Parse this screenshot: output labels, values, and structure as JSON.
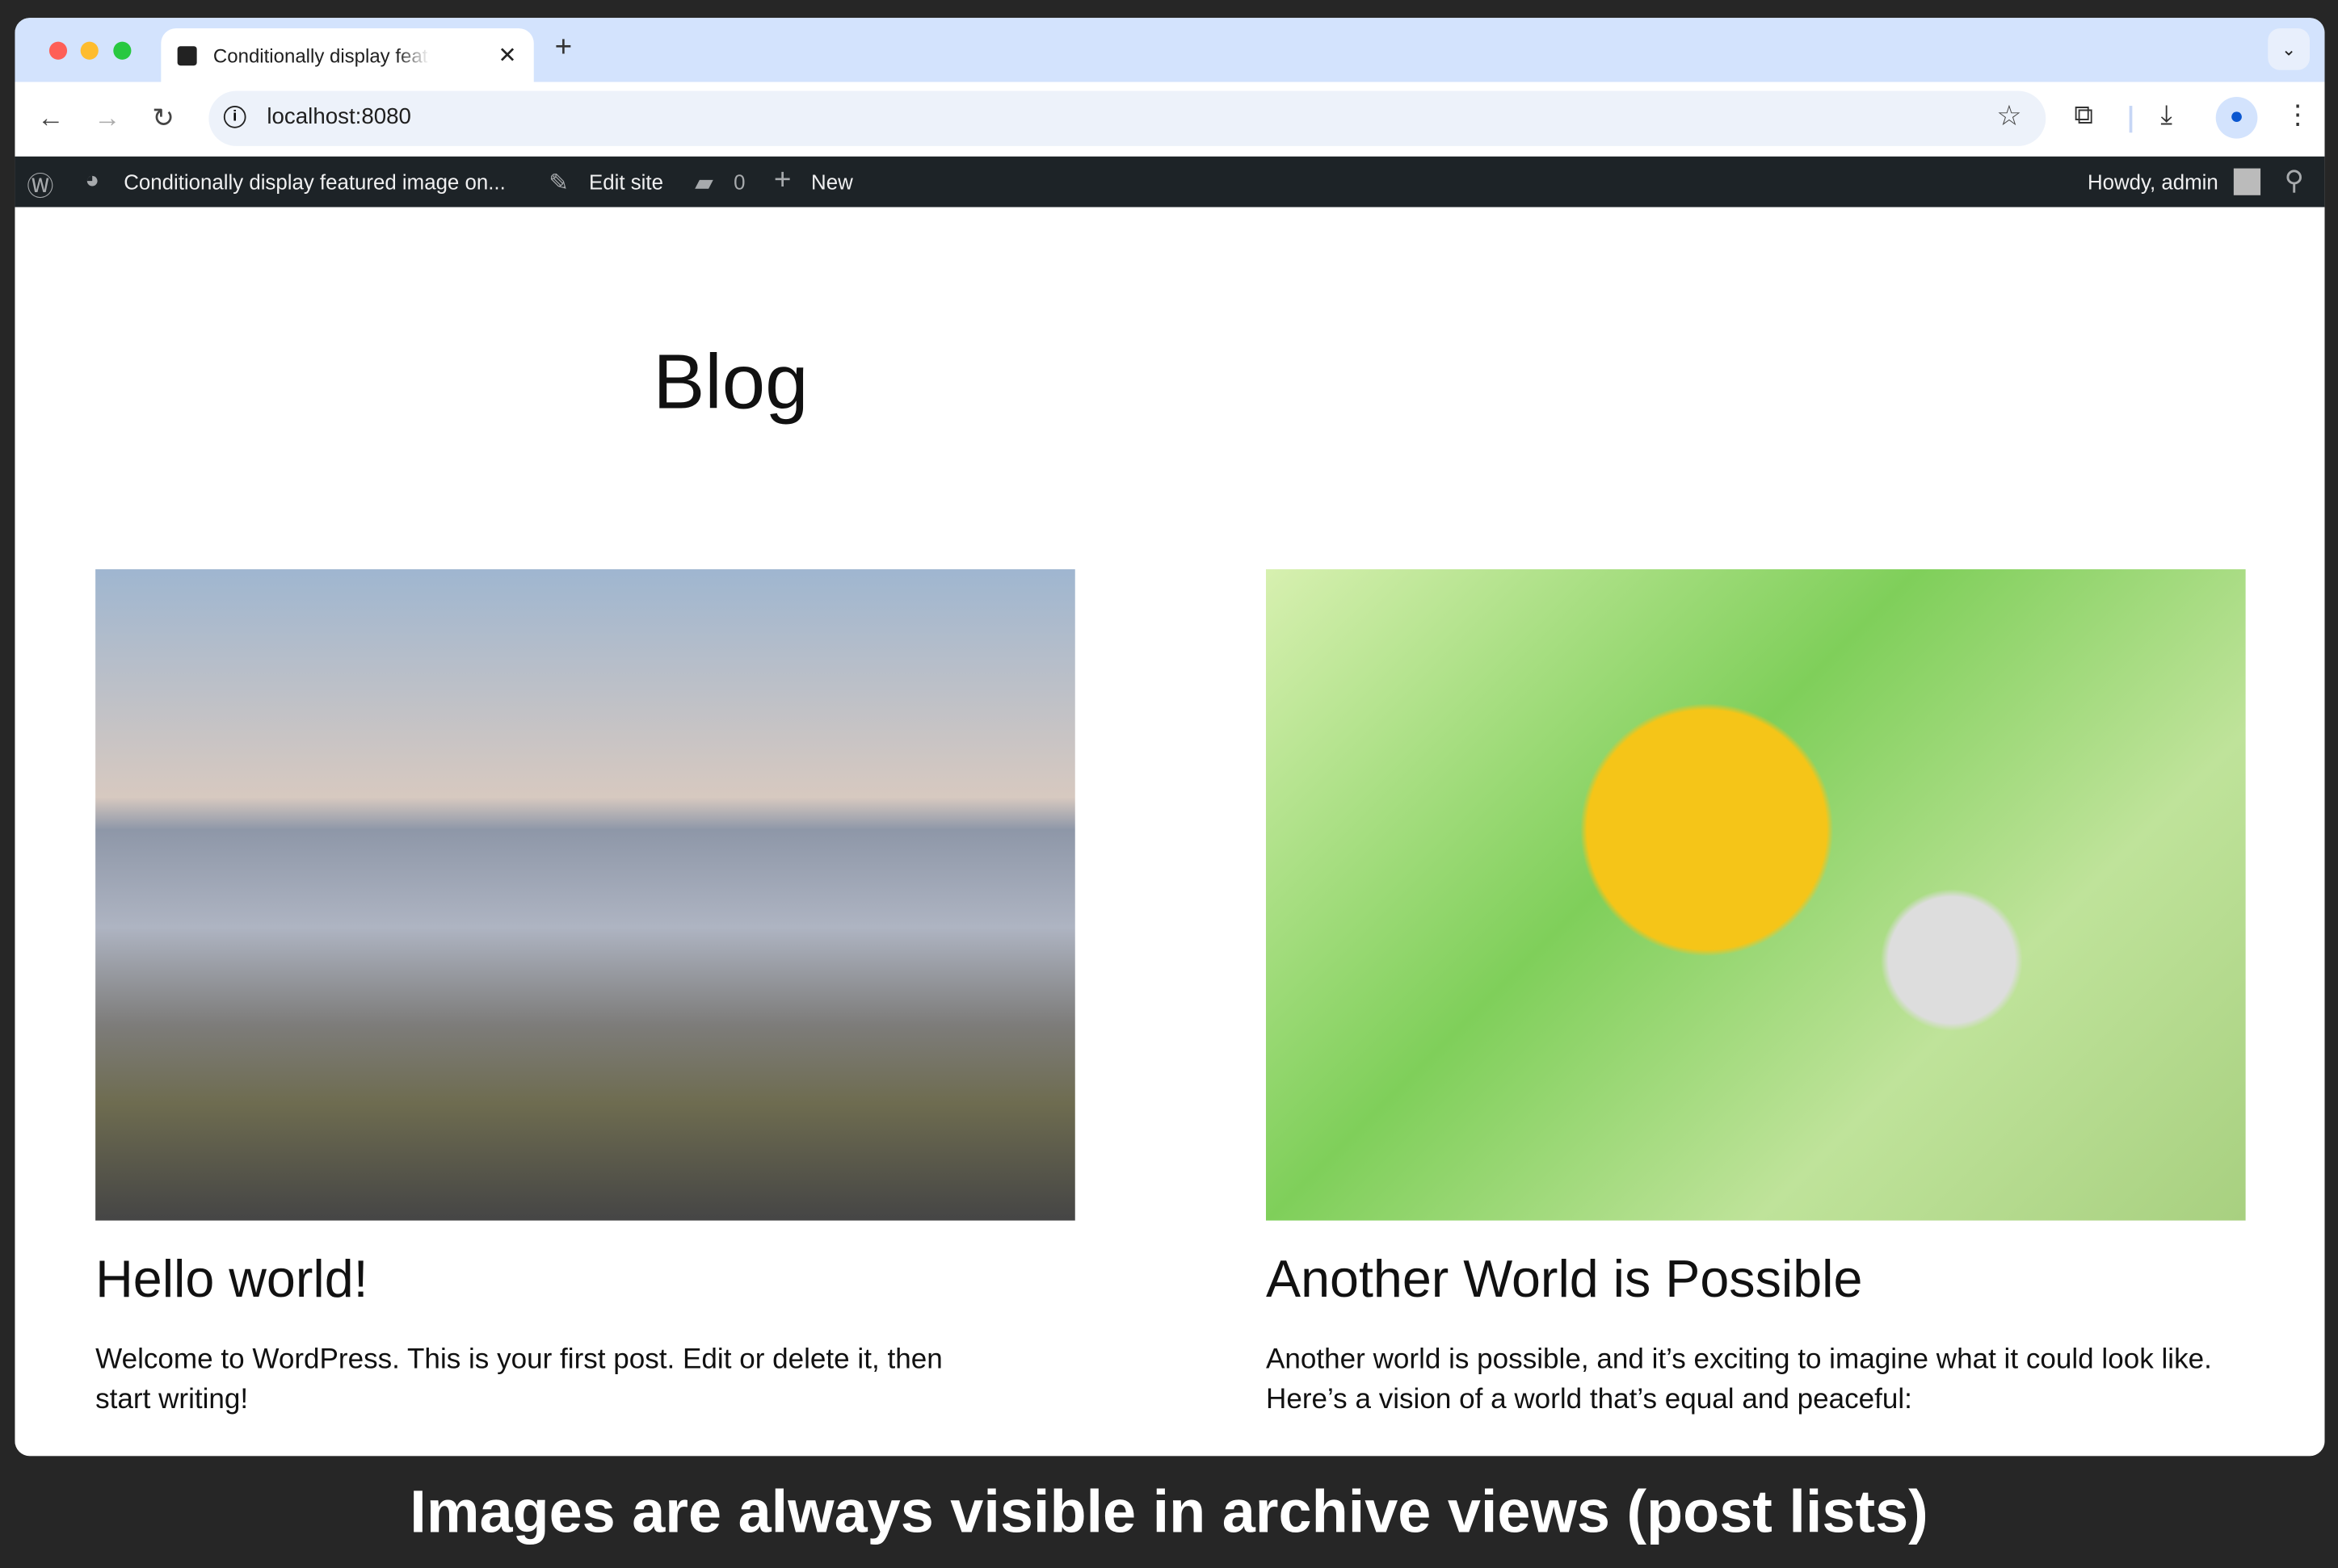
{
  "browser": {
    "tab_title": "Conditionally display featured image on...",
    "url": "localhost:8080",
    "icons": [
      "close-icon",
      "plus-icon",
      "chevron-down-icon",
      "back-icon",
      "forward-icon",
      "reload-icon",
      "info-icon",
      "star-icon",
      "extensions-icon",
      "download-icon",
      "profile-icon",
      "menu-icon"
    ]
  },
  "adminbar": {
    "site_name": "Conditionally display featured image on...",
    "edit_site": "Edit site",
    "comments_count": "0",
    "new_label": "New",
    "howdy": "Howdy, admin"
  },
  "page": {
    "title": "Blog",
    "posts": [
      {
        "title": "Hello world!",
        "excerpt": "Welcome to WordPress. This is your first post. Edit or delete it, then start writing!"
      },
      {
        "title": "Another World is Possible",
        "excerpt": "Another world is possible, and it’s exciting to imagine what it could look like. Here’s a vision of a world that’s equal and peaceful:"
      }
    ]
  },
  "caption": "Images are always visible in archive views (post lists)"
}
